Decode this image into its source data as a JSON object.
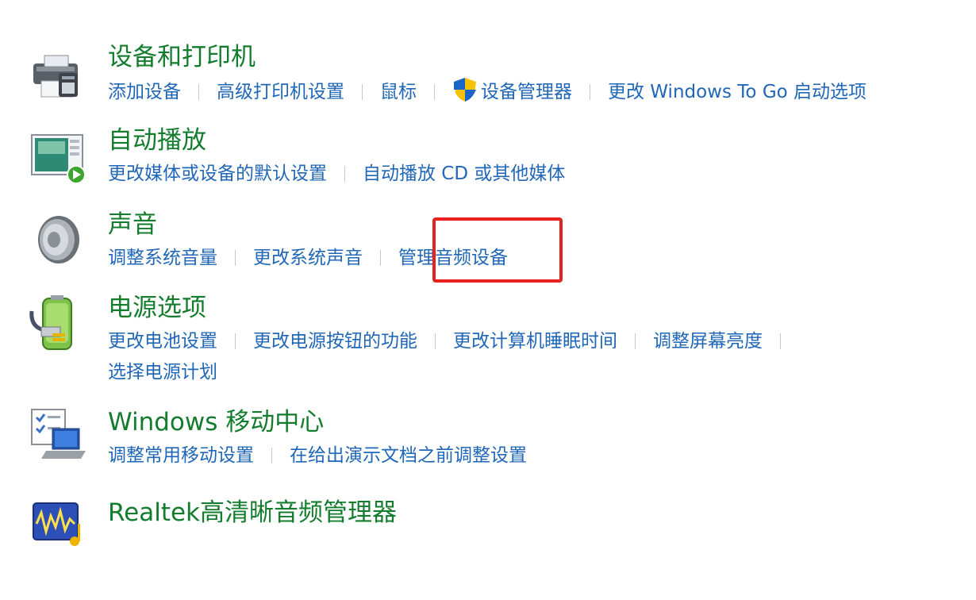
{
  "colors": {
    "title": "#137c2d",
    "link": "#2167b8",
    "separator": "#c8c8c8",
    "highlight": "#e8231f"
  },
  "sections": [
    {
      "icon": "printer-icon",
      "title": "设备和打印机",
      "links": [
        "添加设备",
        "高级打印机设置",
        "鼠标",
        "设备管理器",
        "更改 Windows To Go 启动选项"
      ]
    },
    {
      "icon": "autoplay-icon",
      "title": "自动播放",
      "links": [
        "更改媒体或设备的默认设置",
        "自动播放 CD 或其他媒体"
      ]
    },
    {
      "icon": "speaker-icon",
      "title": "声音",
      "links": [
        "调整系统音量",
        "更改系统声音",
        "管理音频设备"
      ]
    },
    {
      "icon": "battery-power-icon",
      "title": "电源选项",
      "links": [
        "更改电池设置",
        "更改电源按钮的功能",
        "更改计算机睡眠时间",
        "调整屏幕亮度",
        "选择电源计划"
      ]
    },
    {
      "icon": "mobility-center-icon",
      "title": "Windows 移动中心",
      "links": [
        "调整常用移动设置",
        "在给出演示文档之前调整设置"
      ]
    },
    {
      "icon": "realtek-audio-icon",
      "title": "Realtek高清晰音频管理器",
      "links": []
    }
  ]
}
